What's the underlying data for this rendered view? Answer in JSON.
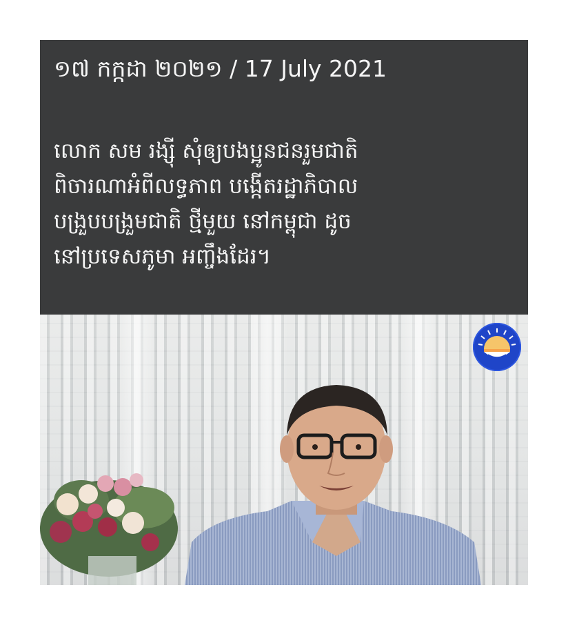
{
  "post": {
    "date_line": "១៧ កក្កដា ២០២១ / 17 July 2021",
    "headline_lines": [
      "លោក សម រង្ស៊ី សុំឲ្យបងប្អូនជនរួមជាតិ",
      "ពិចារណាអំពីលទ្ធភាព បង្កើតរដ្ឋាភិបាល",
      "បង្រួបបង្រួមជាតិ ថ្មីមួយ នៅកម្ពុជា ដូច",
      "នៅប្រទេសភូមា អញ្ចឹងដែរ។"
    ]
  },
  "photo": {
    "logo_icon": "party-sun-logo-icon",
    "colors": {
      "text_panel": "#3a3b3c",
      "text": "#f5f5f5",
      "logo_blue": "#1f45c8"
    }
  }
}
